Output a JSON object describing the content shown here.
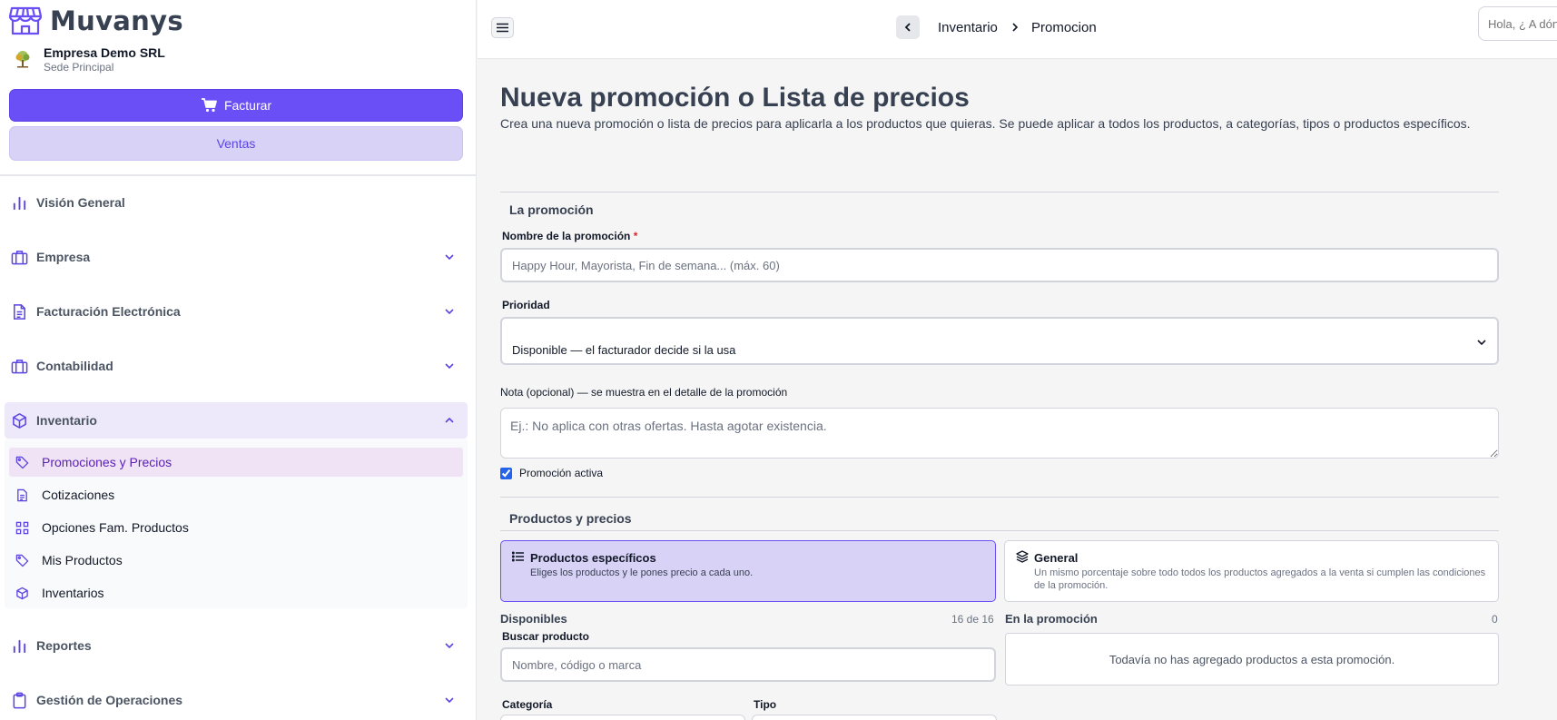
{
  "app": {
    "name": "Muvanys"
  },
  "company": {
    "name": "Empresa Demo SRL",
    "sede": "Sede Principal"
  },
  "sidebar": {
    "facturar_label": "Facturar",
    "ventas_label": "Ventas",
    "items": [
      {
        "label": "Visión General",
        "icon": "bar-chart-icon"
      },
      {
        "label": "Empresa",
        "icon": "briefcase-icon"
      },
      {
        "label": "Facturación Electrónica",
        "icon": "document-icon"
      },
      {
        "label": "Contabilidad",
        "icon": "briefcase-icon"
      },
      {
        "label": "Inventario",
        "icon": "box-icon",
        "expanded": true
      },
      {
        "label": "Reportes",
        "icon": "bar-chart-icon"
      },
      {
        "label": "Gestión de Operaciones",
        "icon": "clipboard-icon"
      }
    ],
    "sub_items": [
      {
        "label": "Promociones y Precios",
        "icon": "tag-icon",
        "active": true
      },
      {
        "label": "Cotizaciones",
        "icon": "document-icon"
      },
      {
        "label": "Opciones Fam. Productos",
        "icon": "grid-icon"
      },
      {
        "label": "Mis Productos",
        "icon": "tag-icon"
      },
      {
        "label": "Inventarios",
        "icon": "box-icon"
      }
    ]
  },
  "header": {
    "breadcrumb": [
      "Inventario",
      "Promocion"
    ],
    "search_placeholder": "Hola, ¿ A dónde quieres ir?"
  },
  "page": {
    "title": "Nueva promoción o Lista de precios",
    "description": "Crea una nueva promoción o lista de precios para aplicarla a los productos que quieras. Se puede aplicar a todos los productos, a categorías, tipos o productos específicos."
  },
  "form": {
    "section_promo": "La promoción",
    "name_label": "Nombre de la promoción",
    "name_required_mark": "*",
    "name_placeholder": "Happy Hour, Mayorista, Fin de semana... (máx. 60)",
    "priority_label": "Prioridad",
    "priority_value": "Disponible — el facturador decide si la usa",
    "note_label": "Nota (opcional) — se muestra en el detalle de la promoción",
    "note_placeholder": "Ej.: No aplica con otras ofertas. Hasta agotar existencia.",
    "active_label": "Promoción activa",
    "active_checked": true,
    "section_products": "Productos y precios",
    "mode_specific_title": "Productos específicos",
    "mode_specific_desc": "Eliges los productos y le pones precio a cada uno.",
    "mode_general_title": "General",
    "mode_general_desc": "Un mismo porcentaje sobre todo todos los productos agregados a la venta si cumplen las condiciones de la promoción.",
    "available_label": "Disponibles",
    "available_count": "16 de 16",
    "in_promo_label": "En la promoción",
    "in_promo_count": "0",
    "search_product_label": "Buscar producto",
    "search_product_placeholder": "Nombre, código o marca",
    "empty_message": "Todavía no has agregado productos a esta promoción.",
    "category_label": "Categoría",
    "type_label": "Tipo"
  },
  "colors": {
    "accent": "#6a4ef6",
    "accent_light": "#d8d2f6",
    "active_sub": "#f0e3f5"
  }
}
